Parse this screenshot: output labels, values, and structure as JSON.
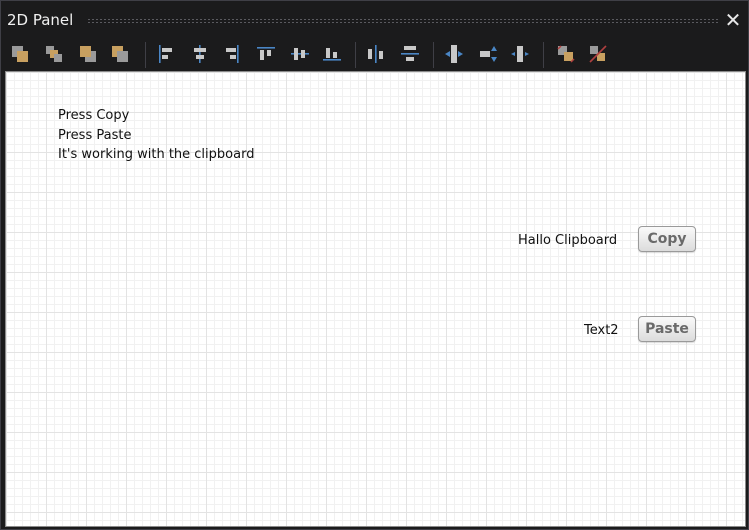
{
  "window": {
    "title": "2D Panel",
    "close_glyph": "✕"
  },
  "toolbar": {
    "groups": [
      [
        "bring-to-front-icon",
        "bring-forward-icon",
        "send-backward-icon",
        "send-to-back-icon"
      ],
      [
        "align-left-icon",
        "align-center-horizontal-icon",
        "align-right-icon",
        "align-top-icon",
        "align-middle-vertical-icon",
        "align-bottom-icon"
      ],
      [
        "distribute-horizontal-icon",
        "distribute-vertical-icon"
      ],
      [
        "same-width-icon",
        "same-height-icon",
        "same-size-icon"
      ],
      [
        "group-icon",
        "ungroup-icon"
      ]
    ],
    "accent": "#c8a060",
    "icon_color": "#c8c8c8",
    "blue": "#4a86c5"
  },
  "canvas": {
    "info_lines": [
      "Press Copy",
      "Press Paste",
      "It's working with the clipboard"
    ],
    "text1": "Hallo Clipboard",
    "text2": "Text2",
    "copy_label": "Copy",
    "paste_label": "Paste"
  }
}
